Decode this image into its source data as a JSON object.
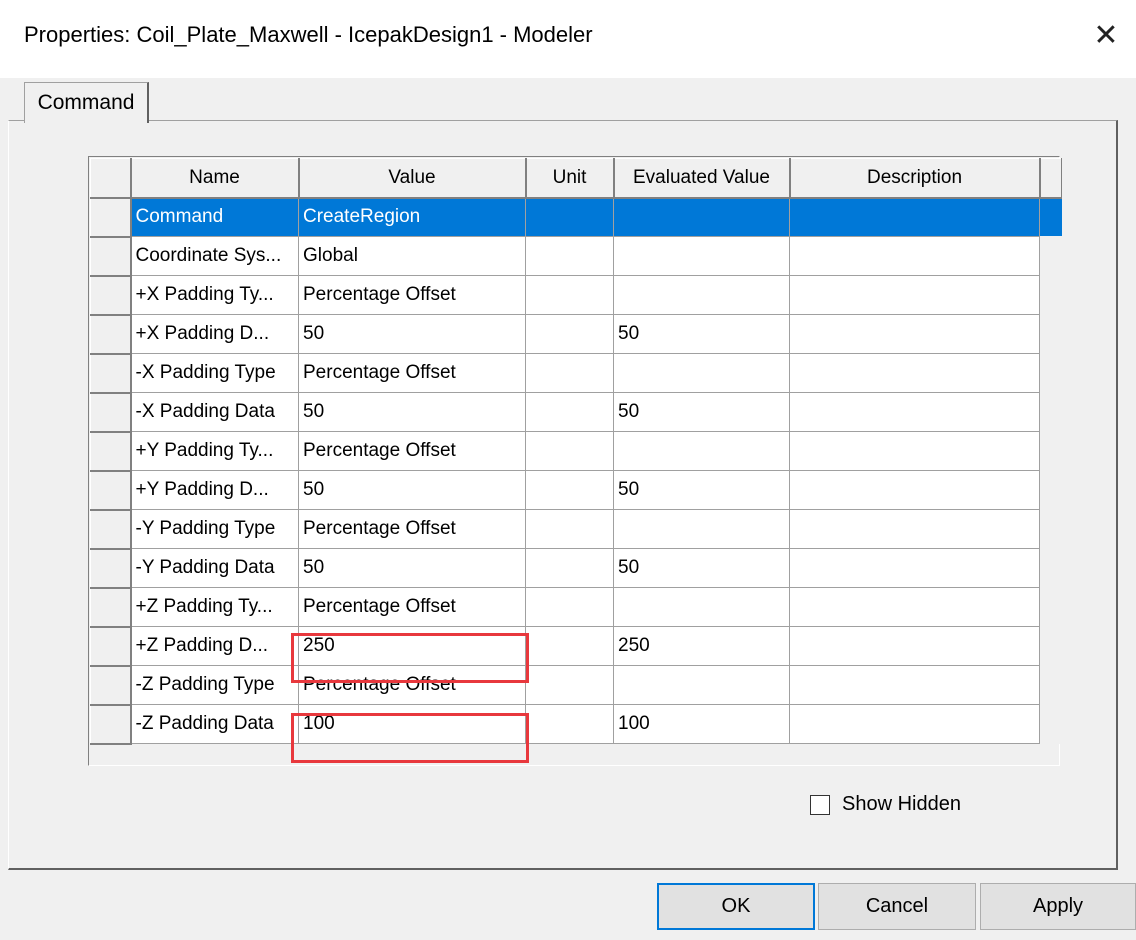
{
  "window": {
    "title": "Properties: Coil_Plate_Maxwell - IcepakDesign1 - Modeler",
    "close_glyph": "✕"
  },
  "tabs": [
    {
      "label": "Command",
      "active": true
    }
  ],
  "grid": {
    "columns": [
      "Name",
      "Value",
      "Unit",
      "Evaluated Value",
      "Description"
    ],
    "rows": [
      {
        "name": "Command",
        "value": "CreateRegion",
        "unit": "",
        "evaluated": "",
        "description": "",
        "selected": true
      },
      {
        "name": "Coordinate Sys...",
        "value": "Global",
        "unit": "",
        "evaluated": "",
        "description": ""
      },
      {
        "name": "+X Padding Ty...",
        "value": "Percentage Offset",
        "unit": "",
        "evaluated": "",
        "description": ""
      },
      {
        "name": "+X Padding D...",
        "value": "50",
        "unit": "",
        "evaluated": "50",
        "description": ""
      },
      {
        "name": "-X Padding Type",
        "value": "Percentage Offset",
        "unit": "",
        "evaluated": "",
        "description": ""
      },
      {
        "name": "-X Padding Data",
        "value": "50",
        "unit": "",
        "evaluated": "50",
        "description": ""
      },
      {
        "name": "+Y Padding Ty...",
        "value": "Percentage Offset",
        "unit": "",
        "evaluated": "",
        "description": ""
      },
      {
        "name": "+Y Padding D...",
        "value": "50",
        "unit": "",
        "evaluated": "50",
        "description": ""
      },
      {
        "name": "-Y Padding Type",
        "value": "Percentage Offset",
        "unit": "",
        "evaluated": "",
        "description": ""
      },
      {
        "name": "-Y Padding Data",
        "value": "50",
        "unit": "",
        "evaluated": "50",
        "description": ""
      },
      {
        "name": "+Z Padding Ty...",
        "value": "Percentage Offset",
        "unit": "",
        "evaluated": "",
        "description": ""
      },
      {
        "name": "+Z Padding D...",
        "value": "250",
        "unit": "",
        "evaluated": "250",
        "description": "",
        "highlighted": true
      },
      {
        "name": "-Z Padding Type",
        "value": "Percentage Offset",
        "unit": "",
        "evaluated": "",
        "description": ""
      },
      {
        "name": "-Z Padding Data",
        "value": "100",
        "unit": "",
        "evaluated": "100",
        "description": "",
        "highlighted": true
      }
    ]
  },
  "show_hidden": {
    "label": "Show Hidden",
    "checked": false
  },
  "buttons": {
    "ok": "OK",
    "cancel": "Cancel",
    "apply": "Apply"
  },
  "colors": {
    "selection": "#0078d7",
    "highlight_box": "#e8383d"
  }
}
